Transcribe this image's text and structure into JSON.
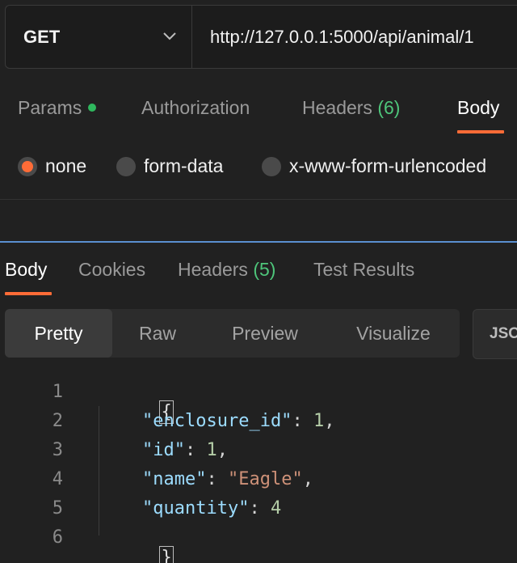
{
  "request": {
    "method": "GET",
    "url": "http://127.0.0.1:5000/api/animal/1"
  },
  "request_tabs": {
    "params": "Params",
    "authorization": "Authorization",
    "headers": "Headers",
    "headers_count": "(6)",
    "body": "Body"
  },
  "body_types": {
    "none": "none",
    "form_data": "form-data",
    "urlencoded": "x-www-form-urlencoded"
  },
  "response_tabs": {
    "body": "Body",
    "cookies": "Cookies",
    "headers": "Headers",
    "headers_count": "(5)",
    "test_results": "Test Results"
  },
  "view_modes": {
    "pretty": "Pretty",
    "raw": "Raw",
    "preview": "Preview",
    "visualize": "Visualize",
    "format": "JSON"
  },
  "response_body": {
    "line_numbers": [
      "1",
      "2",
      "3",
      "4",
      "5",
      "6"
    ],
    "open_brace": "{",
    "close_brace": "}",
    "fields": [
      {
        "key": "\"enclosure_id\"",
        "value": "1",
        "type": "number"
      },
      {
        "key": "\"id\"",
        "value": "1",
        "type": "number"
      },
      {
        "key": "\"name\"",
        "value": "\"Eagle\"",
        "type": "string"
      },
      {
        "key": "\"quantity\"",
        "value": "4",
        "type": "number"
      }
    ]
  },
  "colors": {
    "accent": "#ff6c37",
    "count_green": "#4ec57a",
    "splitter_blue": "#5a8fd0",
    "json_key": "#9cdcfe",
    "json_number": "#b5cea8",
    "json_string": "#ce9178"
  },
  "icons": {
    "method_dropdown": "chevron-down-icon",
    "params_indicator": "green-dot-icon"
  }
}
